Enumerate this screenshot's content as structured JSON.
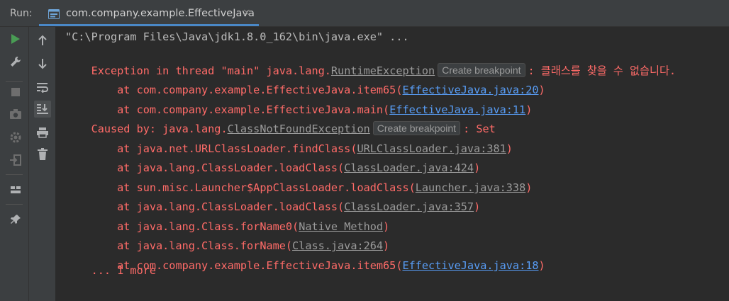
{
  "tabbar": {
    "run_label": "Run:",
    "tab_title": "com.company.example.EffectiveJava",
    "close_glyph": "×"
  },
  "colors": {
    "background": "#2b2b2b",
    "toolbar": "#3c3f41",
    "error_text": "#ff6b68",
    "link_blue": "#589df6",
    "link_gray": "#9a9a9a",
    "accent": "#4a88c7",
    "run_green": "#499c54"
  },
  "toolbar_left": {
    "buttons": [
      {
        "name": "rerun-icon"
      },
      {
        "name": "wrench-icon"
      },
      {
        "name": "stop-icon"
      },
      {
        "name": "camera-icon"
      },
      {
        "name": "gear-icon"
      },
      {
        "name": "exit-icon"
      },
      {
        "name": "layout-icon"
      },
      {
        "name": "pin-icon"
      }
    ]
  },
  "toolbar_right": {
    "buttons": [
      {
        "name": "up-arrow-icon"
      },
      {
        "name": "down-arrow-icon"
      },
      {
        "name": "soft-wrap-icon"
      },
      {
        "name": "scroll-to-end-icon"
      },
      {
        "name": "print-icon"
      },
      {
        "name": "trash-icon"
      }
    ]
  },
  "console": {
    "command_line": "\"C:\\Program Files\\Java\\jdk1.8.0_162\\bin\\java.exe\" ...",
    "breakpoint_chip": "Create breakpoint",
    "exception": {
      "prefix": "Exception in thread \"main\" java.lang.",
      "class": "RuntimeException",
      "message": ": 클래스를 찾을 수 없습니다."
    },
    "exception_frames": [
      {
        "prefix": "    at com.company.example.EffectiveJava.item65(",
        "link": "EffectiveJava.java:20",
        "suffix": ")"
      },
      {
        "prefix": "    at com.company.example.EffectiveJava.main(",
        "link": "EffectiveJava.java:11",
        "suffix": ")"
      }
    ],
    "caused_by": {
      "prefix": "Caused by: java.lang.",
      "class": "ClassNotFoundException",
      "message": ": Set"
    },
    "cause_frames": [
      {
        "prefix": "    at java.net.URLClassLoader.findClass(",
        "link": "URLClassLoader.java:381",
        "suffix": ")"
      },
      {
        "prefix": "    at java.lang.ClassLoader.loadClass(",
        "link": "ClassLoader.java:424",
        "suffix": ")"
      },
      {
        "prefix": "    at sun.misc.Launcher$AppClassLoader.loadClass(",
        "link": "Launcher.java:338",
        "suffix": ")"
      },
      {
        "prefix": "    at java.lang.ClassLoader.loadClass(",
        "link": "ClassLoader.java:357",
        "suffix": ")"
      },
      {
        "prefix": "    at java.lang.Class.forName0(",
        "link": "Native Method",
        "suffix": ")"
      },
      {
        "prefix": "    at java.lang.Class.forName(",
        "link": "Class.java:264",
        "suffix": ")"
      },
      {
        "prefix": "    at com.company.example.EffectiveJava.item65(",
        "link": "EffectiveJava.java:18",
        "suffix": ")"
      }
    ],
    "more": "    ... 1 more"
  }
}
